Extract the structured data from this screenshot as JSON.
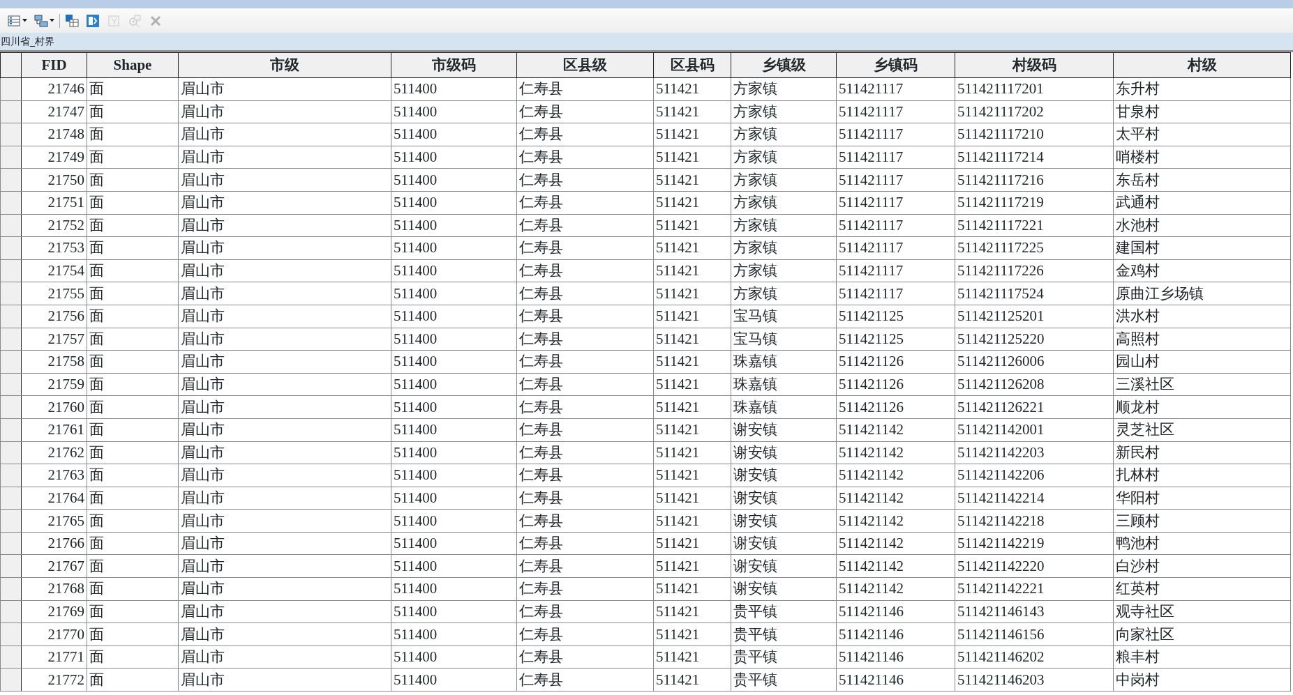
{
  "toolbar": [
    {
      "kind": "table-options",
      "caret": true,
      "disabled": false
    },
    {
      "kind": "related-tables",
      "caret": true,
      "disabled": false
    },
    {
      "kind": "select-by-attributes",
      "caret": false,
      "disabled": false
    },
    {
      "kind": "switch-selection",
      "caret": false,
      "disabled": false
    },
    {
      "kind": "clear-selection",
      "caret": false,
      "disabled": true
    },
    {
      "kind": "zoom-selected",
      "caret": false,
      "disabled": true
    },
    {
      "kind": "delete",
      "caret": false,
      "disabled": true
    }
  ],
  "table_name": "四川省_村界",
  "table": {
    "columns": [
      "FID",
      "Shape",
      "市级",
      "市级码",
      "区县级",
      "区县码",
      "乡镇级",
      "乡镇码",
      "村级码",
      "村级"
    ],
    "rows": [
      [
        "21746",
        "面",
        "眉山市",
        "511400",
        "仁寿县",
        "511421",
        "方家镇",
        "511421117",
        "511421117201",
        "东升村"
      ],
      [
        "21747",
        "面",
        "眉山市",
        "511400",
        "仁寿县",
        "511421",
        "方家镇",
        "511421117",
        "511421117202",
        "甘泉村"
      ],
      [
        "21748",
        "面",
        "眉山市",
        "511400",
        "仁寿县",
        "511421",
        "方家镇",
        "511421117",
        "511421117210",
        "太平村"
      ],
      [
        "21749",
        "面",
        "眉山市",
        "511400",
        "仁寿县",
        "511421",
        "方家镇",
        "511421117",
        "511421117214",
        "哨楼村"
      ],
      [
        "21750",
        "面",
        "眉山市",
        "511400",
        "仁寿县",
        "511421",
        "方家镇",
        "511421117",
        "511421117216",
        "东岳村"
      ],
      [
        "21751",
        "面",
        "眉山市",
        "511400",
        "仁寿县",
        "511421",
        "方家镇",
        "511421117",
        "511421117219",
        "武通村"
      ],
      [
        "21752",
        "面",
        "眉山市",
        "511400",
        "仁寿县",
        "511421",
        "方家镇",
        "511421117",
        "511421117221",
        "水池村"
      ],
      [
        "21753",
        "面",
        "眉山市",
        "511400",
        "仁寿县",
        "511421",
        "方家镇",
        "511421117",
        "511421117225",
        "建国村"
      ],
      [
        "21754",
        "面",
        "眉山市",
        "511400",
        "仁寿县",
        "511421",
        "方家镇",
        "511421117",
        "511421117226",
        "金鸡村"
      ],
      [
        "21755",
        "面",
        "眉山市",
        "511400",
        "仁寿县",
        "511421",
        "方家镇",
        "511421117",
        "511421117524",
        "原曲江乡场镇"
      ],
      [
        "21756",
        "面",
        "眉山市",
        "511400",
        "仁寿县",
        "511421",
        "宝马镇",
        "511421125",
        "511421125201",
        "洪水村"
      ],
      [
        "21757",
        "面",
        "眉山市",
        "511400",
        "仁寿县",
        "511421",
        "宝马镇",
        "511421125",
        "511421125220",
        "高照村"
      ],
      [
        "21758",
        "面",
        "眉山市",
        "511400",
        "仁寿县",
        "511421",
        "珠嘉镇",
        "511421126",
        "511421126006",
        "园山村"
      ],
      [
        "21759",
        "面",
        "眉山市",
        "511400",
        "仁寿县",
        "511421",
        "珠嘉镇",
        "511421126",
        "511421126208",
        "三溪社区"
      ],
      [
        "21760",
        "面",
        "眉山市",
        "511400",
        "仁寿县",
        "511421",
        "珠嘉镇",
        "511421126",
        "511421126221",
        "顺龙村"
      ],
      [
        "21761",
        "面",
        "眉山市",
        "511400",
        "仁寿县",
        "511421",
        "谢安镇",
        "511421142",
        "511421142001",
        "灵芝社区"
      ],
      [
        "21762",
        "面",
        "眉山市",
        "511400",
        "仁寿县",
        "511421",
        "谢安镇",
        "511421142",
        "511421142203",
        "新民村"
      ],
      [
        "21763",
        "面",
        "眉山市",
        "511400",
        "仁寿县",
        "511421",
        "谢安镇",
        "511421142",
        "511421142206",
        "扎林村"
      ],
      [
        "21764",
        "面",
        "眉山市",
        "511400",
        "仁寿县",
        "511421",
        "谢安镇",
        "511421142",
        "511421142214",
        "华阳村"
      ],
      [
        "21765",
        "面",
        "眉山市",
        "511400",
        "仁寿县",
        "511421",
        "谢安镇",
        "511421142",
        "511421142218",
        "三顾村"
      ],
      [
        "21766",
        "面",
        "眉山市",
        "511400",
        "仁寿县",
        "511421",
        "谢安镇",
        "511421142",
        "511421142219",
        "鸭池村"
      ],
      [
        "21767",
        "面",
        "眉山市",
        "511400",
        "仁寿县",
        "511421",
        "谢安镇",
        "511421142",
        "511421142220",
        "白沙村"
      ],
      [
        "21768",
        "面",
        "眉山市",
        "511400",
        "仁寿县",
        "511421",
        "谢安镇",
        "511421142",
        "511421142221",
        "红英村"
      ],
      [
        "21769",
        "面",
        "眉山市",
        "511400",
        "仁寿县",
        "511421",
        "贵平镇",
        "511421146",
        "511421146143",
        "观寺社区"
      ],
      [
        "21770",
        "面",
        "眉山市",
        "511400",
        "仁寿县",
        "511421",
        "贵平镇",
        "511421146",
        "511421146156",
        "向家社区"
      ],
      [
        "21771",
        "面",
        "眉山市",
        "511400",
        "仁寿县",
        "511421",
        "贵平镇",
        "511421146",
        "511421146202",
        "粮丰村"
      ],
      [
        "21772",
        "面",
        "眉山市",
        "511400",
        "仁寿县",
        "511421",
        "贵平镇",
        "511421146",
        "511421146203",
        "中岗村"
      ]
    ]
  }
}
